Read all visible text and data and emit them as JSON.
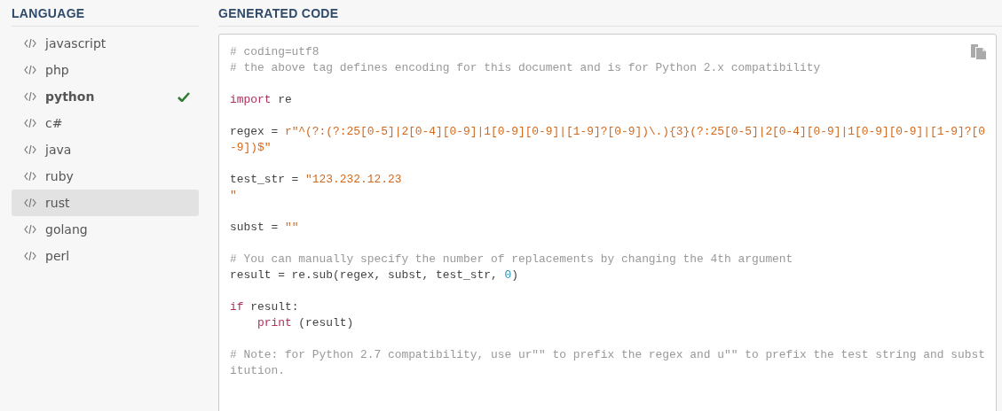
{
  "sidebar": {
    "title": "LANGUAGE",
    "items": [
      {
        "label": "javascript",
        "selected": false,
        "highlighted": false
      },
      {
        "label": "php",
        "selected": false,
        "highlighted": false
      },
      {
        "label": "python",
        "selected": true,
        "highlighted": false
      },
      {
        "label": "c#",
        "selected": false,
        "highlighted": false
      },
      {
        "label": "java",
        "selected": false,
        "highlighted": false
      },
      {
        "label": "ruby",
        "selected": false,
        "highlighted": false
      },
      {
        "label": "rust",
        "selected": false,
        "highlighted": true
      },
      {
        "label": "golang",
        "selected": false,
        "highlighted": false
      },
      {
        "label": "perl",
        "selected": false,
        "highlighted": false
      }
    ]
  },
  "code_panel": {
    "title": "GENERATED CODE",
    "blocks": [
      [
        [
          {
            "kind": "comment",
            "text": "# coding=utf8"
          }
        ],
        [
          {
            "kind": "comment",
            "text": "# the above tag defines encoding for this document and is for Python 2.x compatibility"
          }
        ]
      ],
      [
        [
          {
            "kind": "keyword",
            "text": "import"
          },
          {
            "kind": "plain",
            "text": " re"
          }
        ]
      ],
      [
        [
          {
            "kind": "plain",
            "text": "regex = "
          },
          {
            "kind": "string",
            "text": "r\"^(?:(?:25[0-5]|2[0-4][0-9]|1[0-9][0-9]|[1-9]?[0-9])\\.){3}(?:25[0-5]|2[0-4][0-9]|1[0-9][0-9]|[1-9]?[0"
          }
        ],
        [
          {
            "kind": "string",
            "text": "-9])$\""
          }
        ]
      ],
      [
        [
          {
            "kind": "plain",
            "text": "test_str = "
          },
          {
            "kind": "string",
            "text": "\"123.232.12.23"
          }
        ],
        [
          {
            "kind": "string",
            "text": "\""
          }
        ]
      ],
      [
        [
          {
            "kind": "plain",
            "text": "subst = "
          },
          {
            "kind": "string",
            "text": "\"\""
          }
        ]
      ],
      [
        [
          {
            "kind": "comment",
            "text": "# You can manually specify the number of replacements by changing the 4th argument"
          }
        ],
        [
          {
            "kind": "plain",
            "text": "result = re.sub(regex, subst, test_str, "
          },
          {
            "kind": "number",
            "text": "0"
          },
          {
            "kind": "plain",
            "text": ")"
          }
        ]
      ],
      [
        [
          {
            "kind": "keyword",
            "text": "if"
          },
          {
            "kind": "plain",
            "text": " result:"
          }
        ],
        {
          "indented": true,
          "tokens": [
            {
              "kind": "keyword",
              "text": "print"
            },
            {
              "kind": "plain",
              "text": " (result)"
            }
          ]
        }
      ],
      [
        [
          {
            "kind": "comment",
            "text": "# Note: for Python 2.7 compatibility, use ur\"\" to prefix the regex and u\"\" to prefix the test string and subst"
          }
        ],
        [
          {
            "kind": "comment",
            "text": "itution."
          }
        ]
      ]
    ]
  }
}
